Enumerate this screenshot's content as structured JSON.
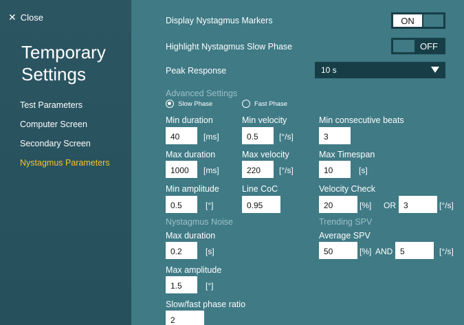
{
  "sidebar": {
    "close_label": "Close",
    "title_line1": "Temporary",
    "title_line2": "Settings",
    "items": [
      {
        "label": "Test Parameters"
      },
      {
        "label": "Computer Screen"
      },
      {
        "label": "Secondary Screen"
      },
      {
        "label": "Nystagmus Parameters",
        "active": true
      }
    ]
  },
  "colors": {
    "active_nav": "#f2c230",
    "panel_bg": "#3f7a85",
    "sidebar_bg": "#2c5562",
    "toggle_bg": "#173e47"
  },
  "settings": {
    "display_markers": {
      "label": "Display Nystagmus Markers",
      "state": "ON"
    },
    "highlight_slow": {
      "label": "Highlight Nystagmus Slow Phase",
      "state": "OFF"
    },
    "peak_response": {
      "label": "Peak Response",
      "value": "10 s"
    }
  },
  "advanced": {
    "heading": "Advanced Settings",
    "radio_slow": "Slow Phase",
    "radio_fast": "Fast Phase",
    "selected": "Slow Phase",
    "min_duration": {
      "label": "Min duration",
      "value": "40",
      "unit": "[ms]"
    },
    "min_velocity": {
      "label": "Min velocity",
      "value": "0.5",
      "unit": "[°/s]"
    },
    "min_consecutive": {
      "label": "Min consecutive beats",
      "value": "3"
    },
    "max_duration": {
      "label": "Max duration",
      "value": "1000",
      "unit": "[ms]"
    },
    "max_velocity": {
      "label": "Max velocity",
      "value": "220",
      "unit": "[°/s]"
    },
    "max_timespan": {
      "label": "Max Timespan",
      "value": "10",
      "unit": "[s]"
    },
    "min_amplitude": {
      "label": "Min amplitude",
      "value": "0.5",
      "unit": "[°]"
    },
    "line_coc": {
      "label": "Line CoC",
      "value": "0.95"
    },
    "velocity_check": {
      "label": "Velocity Check",
      "value1": "20",
      "unit1": "[%]",
      "joiner": "OR",
      "value2": "3",
      "unit2": "[°/s]"
    }
  },
  "noise": {
    "heading": "Nystagmus Noise",
    "max_duration": {
      "label": "Max duration",
      "value": "0.2",
      "unit": "[s]"
    },
    "max_amplitude": {
      "label": "Max amplitude",
      "value": "1.5",
      "unit": "[°]"
    },
    "ratio": {
      "label": "Slow/fast phase ratio",
      "value": "2"
    }
  },
  "trending": {
    "heading": "Trending SPV",
    "average_spv": {
      "label": "Average SPV",
      "value1": "50",
      "unit1": "[%]",
      "joiner": "AND",
      "value2": "5",
      "unit2": "[°/s]"
    }
  }
}
